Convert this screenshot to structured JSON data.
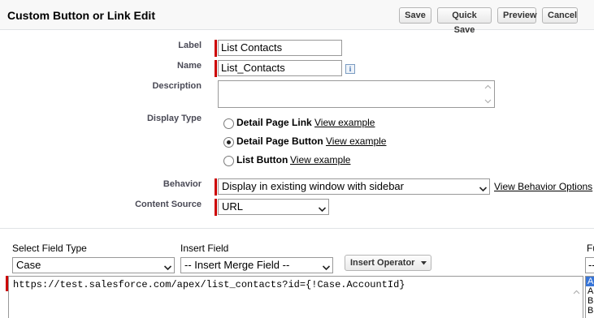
{
  "header": {
    "title": "Custom Button or Link Edit",
    "buttons": {
      "save": "Save",
      "quick_save": "Quick Save",
      "preview": "Preview",
      "cancel": "Cancel"
    }
  },
  "form": {
    "label": {
      "caption": "Label",
      "value": "List Contacts"
    },
    "name": {
      "caption": "Name",
      "value": "List_Contacts",
      "info_icon": "i"
    },
    "description": {
      "caption": "Description",
      "value": ""
    },
    "display_type": {
      "caption": "Display Type",
      "options": [
        {
          "label": "Detail Page Link",
          "link": "View example",
          "selected": false
        },
        {
          "label": "Detail Page Button",
          "link": "View example",
          "selected": true
        },
        {
          "label": "List Button",
          "link": "View example",
          "selected": false
        }
      ]
    },
    "behavior": {
      "caption": "Behavior",
      "value": "Display in existing window with sidebar",
      "link": "View Behavior Options"
    },
    "content_source": {
      "caption": "Content Source",
      "value": "URL"
    }
  },
  "formula_editor": {
    "select_field_type": {
      "caption": "Select Field Type",
      "value": "Case"
    },
    "insert_field": {
      "caption": "Insert Field",
      "value": "-- Insert Merge Field --"
    },
    "insert_operator": {
      "label": "Insert Operator"
    },
    "functions": {
      "caption": "Fu",
      "value": "--",
      "list": [
        "A",
        "A",
        "B",
        "B"
      ]
    },
    "formula_text": "https://test.salesforce.com/apex/list_contacts?id={!Case.AccountId}"
  },
  "colors": {
    "required": "#cc0000",
    "header_bg": "#f8f8f8",
    "selected_item": "#3875d7"
  }
}
